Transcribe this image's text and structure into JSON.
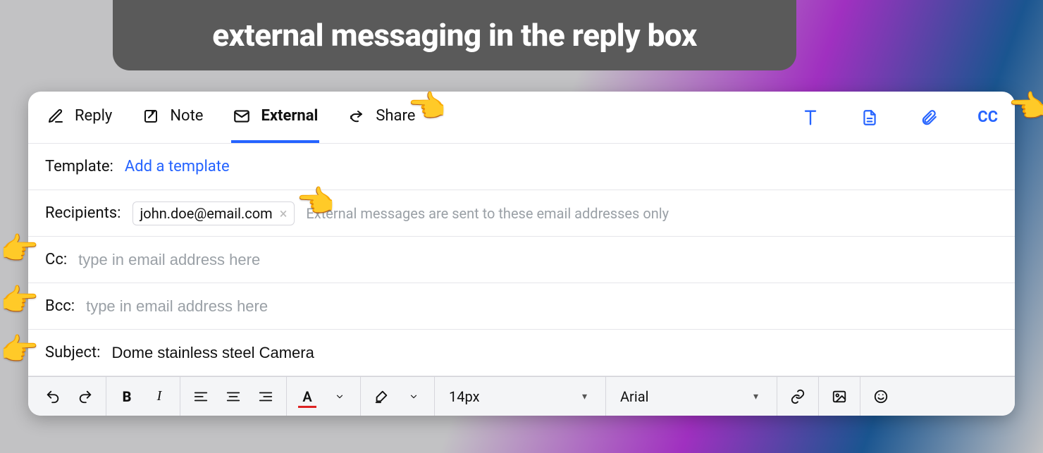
{
  "banner": {
    "title": "external messaging in the reply box"
  },
  "tabs": {
    "reply": {
      "label": "Reply"
    },
    "note": {
      "label": "Note"
    },
    "external": {
      "label": "External"
    },
    "share": {
      "label": "Share"
    },
    "cc_link": "CC"
  },
  "template": {
    "label": "Template:",
    "link": "Add a template"
  },
  "recipients": {
    "label": "Recipients:",
    "chip": "john.doe@email.com",
    "hint": "External messages are sent to these email addresses only"
  },
  "cc": {
    "label": "Cc:",
    "placeholder": "type in email address here"
  },
  "bcc": {
    "label": "Bcc:",
    "placeholder": "type in email address here"
  },
  "subject": {
    "label": "Subject:",
    "value": "Dome stainless steel Camera"
  },
  "toolbar": {
    "font_size": "14px",
    "font_family": "Arial"
  }
}
